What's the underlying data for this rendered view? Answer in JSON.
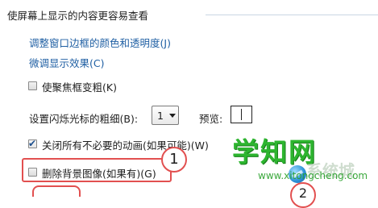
{
  "section": {
    "heading": "使屏幕上显示的内容更容易查看"
  },
  "links": {
    "adjust_window": "调整窗口边框的颜色和透明度(J)",
    "fine_tune": "微调显示效果(C)"
  },
  "options": {
    "thicken_focus": {
      "label": "使聚焦框变粗(K)",
      "checked": false
    },
    "cursor_thickness": {
      "label": "设置闪烁光标的粗细(B):",
      "value": "1",
      "preview_label": "预览:"
    },
    "disable_animations": {
      "label": "关闭所有不必要的动画(如果可能)(W)",
      "checked": true
    },
    "remove_background": {
      "label": "删除背景图像(如果有)(G)",
      "checked": false
    }
  },
  "annotations": {
    "step1": "1",
    "step2": "2"
  },
  "watermark": {
    "title": "学知网",
    "url": "www.xitongcheng.com",
    "brand": "系统城"
  },
  "colors": {
    "link": "#1f5fa3",
    "annotation": "#e25050",
    "watermark": "#2db52f"
  }
}
